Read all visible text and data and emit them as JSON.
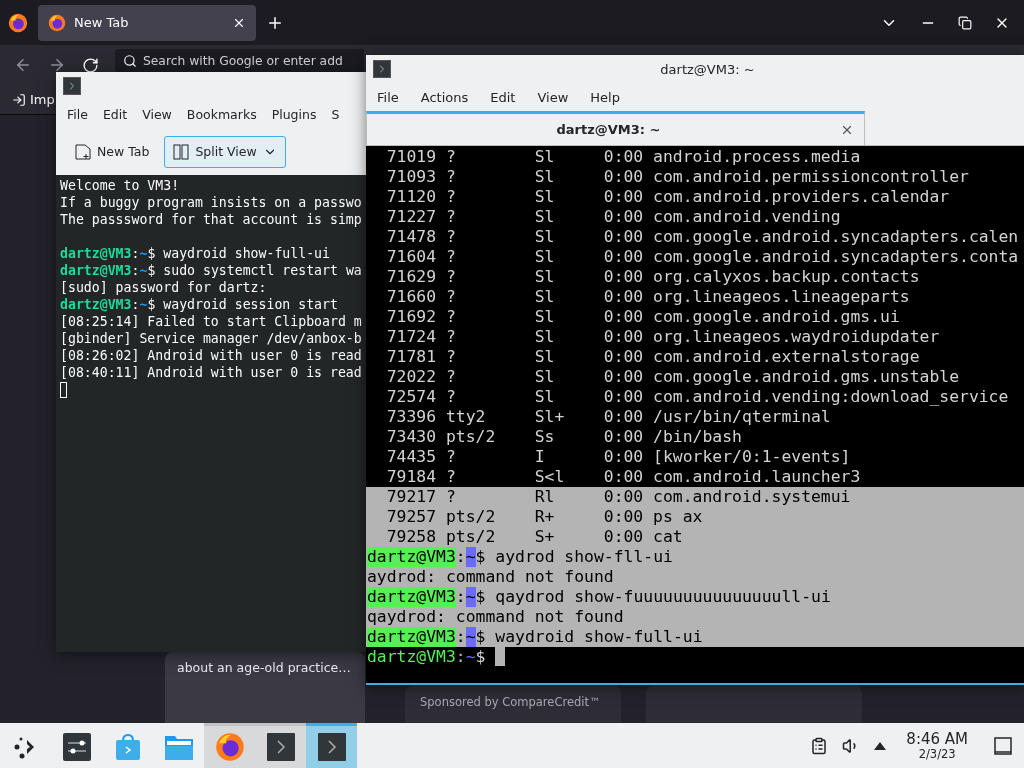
{
  "browser": {
    "tabs": [
      {
        "title": "New Tab",
        "selected": true
      }
    ],
    "url_bar": {
      "placeholder": "Search with Google or enter add"
    },
    "bookmarks": [
      {
        "label": "Imp"
      }
    ],
    "cards": [
      {
        "kind": "story",
        "text": "about an age-old practice…"
      },
      {
        "kind": "sponsored",
        "text": "Sponsored by CompareCredit™"
      },
      {
        "kind": "blank"
      }
    ]
  },
  "konsole": {
    "menu": [
      "File",
      "Edit",
      "View",
      "Bookmarks",
      "Plugins",
      "S"
    ],
    "toolbar": [
      {
        "kind": "new-tab",
        "label": "New Tab",
        "highlighted": false
      },
      {
        "kind": "split-view",
        "label": "Split View",
        "highlighted": true
      }
    ],
    "cursor": true,
    "lines": [
      {
        "kind": "output",
        "text": "Welcome to VM3!"
      },
      {
        "kind": "output",
        "text": "If a buggy program insists on a passwo"
      },
      {
        "kind": "output",
        "text": "The passsword for that account is simp"
      },
      {
        "kind": "blank"
      },
      {
        "kind": "prompt",
        "user": "dartz@VM3",
        "sep": ":",
        "path": "~",
        "sign": "$",
        "command": "waydroid show-full-ui"
      },
      {
        "kind": "prompt",
        "user": "dartz@VM3",
        "sep": ":",
        "path": "~",
        "sign": "$",
        "command": "sudo systemctl restart wa"
      },
      {
        "kind": "output",
        "text": "[sudo] password for dartz:"
      },
      {
        "kind": "prompt",
        "user": "dartz@VM3",
        "sep": ":",
        "path": "~",
        "sign": "$",
        "command": "waydroid session start"
      },
      {
        "kind": "output",
        "text": "[08:25:14] Failed to start Clipboard m"
      },
      {
        "kind": "output",
        "text": "[gbinder] Service manager /dev/anbox-b"
      },
      {
        "kind": "output",
        "text": "[08:26:02] Android with user 0 is read"
      },
      {
        "kind": "output",
        "text": "[08:40:11] Android with user 0 is read"
      },
      {
        "kind": "blank"
      }
    ]
  },
  "qterminal": {
    "title": "dartz@VM3: ~",
    "menu": [
      "File",
      "Actions",
      "Edit",
      "View",
      "Help"
    ],
    "tabs": [
      {
        "title": "dartz@VM3: ~",
        "selected": true
      }
    ],
    "cursor": true,
    "lines": [
      {
        "kind": "process",
        "pid": "71019",
        "tty": "?",
        "stat": "Sl",
        "time": "0:00",
        "command": "android.process.media",
        "selected": false
      },
      {
        "kind": "process",
        "pid": "71093",
        "tty": "?",
        "stat": "Sl",
        "time": "0:00",
        "command": "com.android.permissioncontroller",
        "selected": false
      },
      {
        "kind": "process",
        "pid": "71120",
        "tty": "?",
        "stat": "Sl",
        "time": "0:00",
        "command": "com.android.providers.calendar",
        "selected": false
      },
      {
        "kind": "process",
        "pid": "71227",
        "tty": "?",
        "stat": "Sl",
        "time": "0:00",
        "command": "com.android.vending",
        "selected": false
      },
      {
        "kind": "process",
        "pid": "71478",
        "tty": "?",
        "stat": "Sl",
        "time": "0:00",
        "command": "com.google.android.syncadapters.calen",
        "selected": false
      },
      {
        "kind": "process",
        "pid": "71604",
        "tty": "?",
        "stat": "Sl",
        "time": "0:00",
        "command": "com.google.android.syncadapters.conta",
        "selected": false
      },
      {
        "kind": "process",
        "pid": "71629",
        "tty": "?",
        "stat": "Sl",
        "time": "0:00",
        "command": "org.calyxos.backup.contacts",
        "selected": false
      },
      {
        "kind": "process",
        "pid": "71660",
        "tty": "?",
        "stat": "Sl",
        "time": "0:00",
        "command": "org.lineageos.lineageparts",
        "selected": false
      },
      {
        "kind": "process",
        "pid": "71692",
        "tty": "?",
        "stat": "Sl",
        "time": "0:00",
        "command": "com.google.android.gms.ui",
        "selected": false
      },
      {
        "kind": "process",
        "pid": "71724",
        "tty": "?",
        "stat": "Sl",
        "time": "0:00",
        "command": "org.lineageos.waydroidupdater",
        "selected": false
      },
      {
        "kind": "process",
        "pid": "71781",
        "tty": "?",
        "stat": "Sl",
        "time": "0:00",
        "command": "com.android.externalstorage",
        "selected": false
      },
      {
        "kind": "process",
        "pid": "72022",
        "tty": "?",
        "stat": "Sl",
        "time": "0:00",
        "command": "com.google.android.gms.unstable",
        "selected": false
      },
      {
        "kind": "process",
        "pid": "72574",
        "tty": "?",
        "stat": "Sl",
        "time": "0:00",
        "command": "com.android.vending:download_service",
        "selected": false
      },
      {
        "kind": "process",
        "pid": "73396",
        "tty": "tty2",
        "stat": "Sl+",
        "time": "0:00",
        "command": "/usr/bin/qterminal",
        "selected": false
      },
      {
        "kind": "process",
        "pid": "73430",
        "tty": "pts/2",
        "stat": "Ss",
        "time": "0:00",
        "command": "/bin/bash",
        "selected": false
      },
      {
        "kind": "process",
        "pid": "74435",
        "tty": "?",
        "stat": "I",
        "time": "0:00",
        "command": "[kworker/0:1-events]",
        "selected": false
      },
      {
        "kind": "process",
        "pid": "79184",
        "tty": "?",
        "stat": "S<l",
        "time": "0:00",
        "command": "com.android.launcher3",
        "selected": false
      },
      {
        "kind": "process",
        "pid": "79217",
        "tty": "?",
        "stat": "Rl",
        "time": "0:00",
        "command": "com.android.systemui",
        "selected": true
      },
      {
        "kind": "process",
        "pid": "79257",
        "tty": "pts/2",
        "stat": "R+",
        "time": "0:00",
        "command": "ps ax",
        "selected": true
      },
      {
        "kind": "process",
        "pid": "79258",
        "tty": "pts/2",
        "stat": "S+",
        "time": "0:00",
        "command": "cat",
        "selected": true
      },
      {
        "kind": "prompt",
        "user": "dartz@VM3",
        "sep": ":",
        "path": "~",
        "sign": "$",
        "command": "aydrod show-fll-ui",
        "selected": true
      },
      {
        "kind": "output",
        "text": "aydrod: command not found",
        "selected": true
      },
      {
        "kind": "prompt",
        "user": "dartz@VM3",
        "sep": ":",
        "path": "~",
        "sign": "$",
        "command": "qaydrod show-fuuuuuuuuuuuuuuull-ui",
        "selected": true
      },
      {
        "kind": "output",
        "text": "qaydrod: command not found",
        "selected": true
      },
      {
        "kind": "prompt",
        "user": "dartz@VM3",
        "sep": ":",
        "path": "~",
        "sign": "$",
        "command": "waydroid show-full-ui",
        "selected": true
      },
      {
        "kind": "prompt",
        "user": "dartz@VM3",
        "sep": ":",
        "path": "~",
        "sign": "$",
        "selected": false
      }
    ]
  },
  "taskbar": {
    "items": [
      {
        "kind": "launcher",
        "open": false,
        "selected": false
      },
      {
        "kind": "settings",
        "open": false,
        "selected": false
      },
      {
        "kind": "store",
        "open": false,
        "selected": false
      },
      {
        "kind": "files",
        "open": false,
        "selected": false
      },
      {
        "kind": "browser",
        "open": true,
        "selected": false
      },
      {
        "kind": "terminal",
        "open": true,
        "selected": false
      },
      {
        "kind": "terminal",
        "open": true,
        "selected": true
      }
    ],
    "clock": {
      "time": "8:46 AM",
      "date": "2/3/23"
    }
  }
}
